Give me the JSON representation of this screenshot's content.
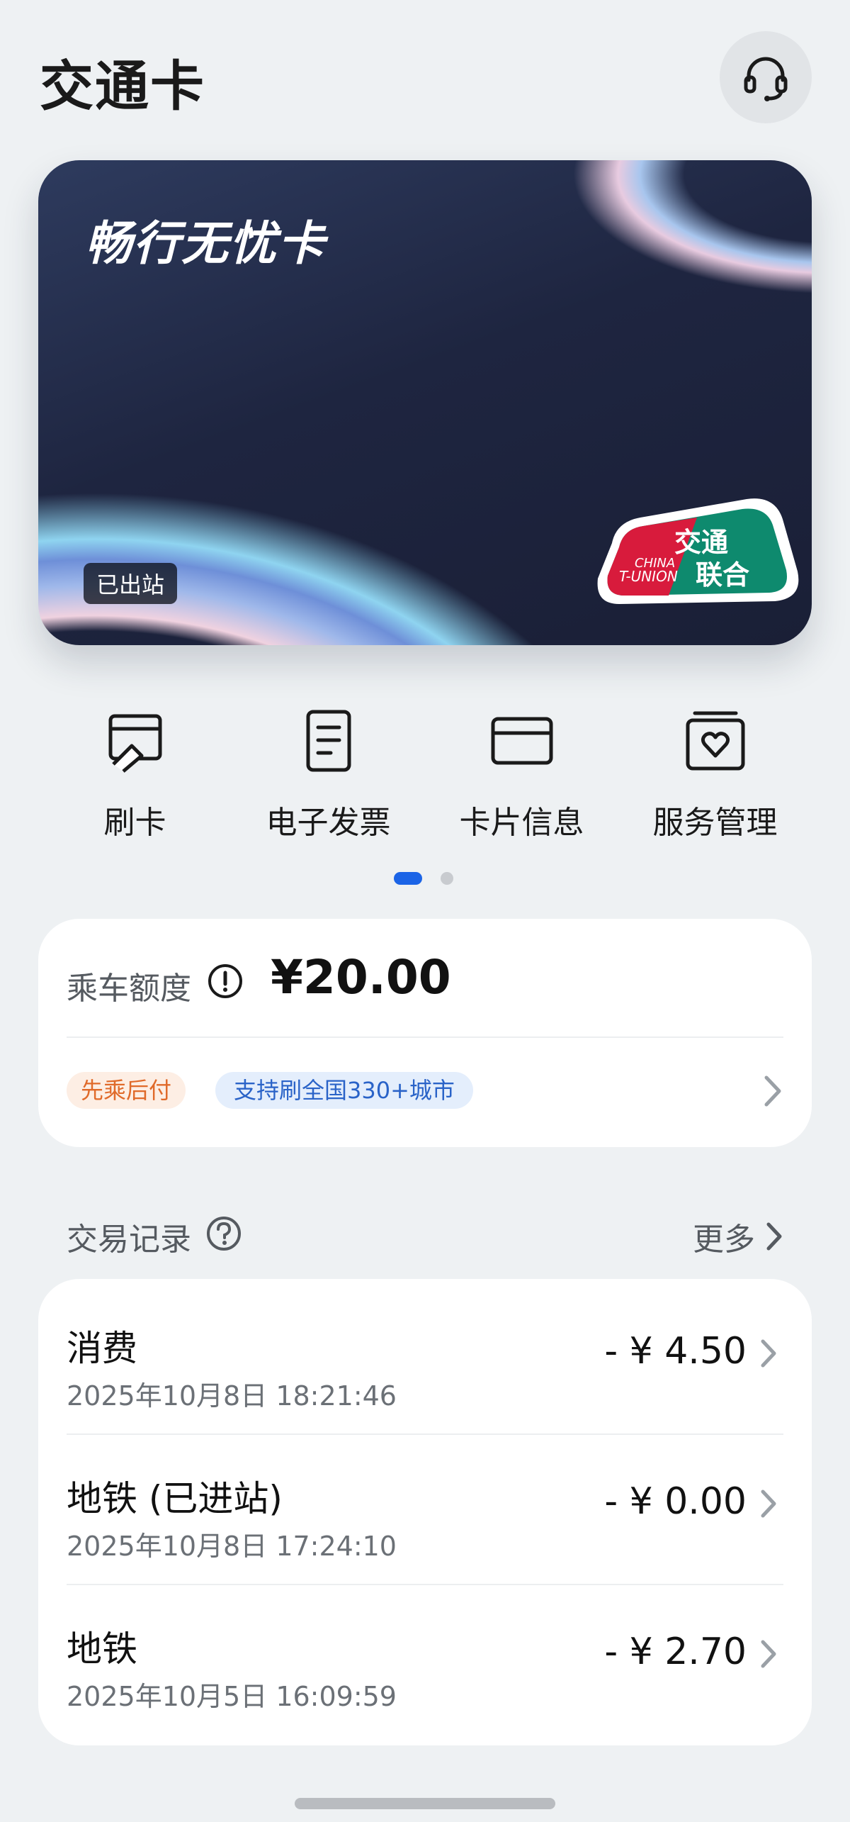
{
  "header": {
    "title": "交通卡"
  },
  "card": {
    "name": "畅行无忧卡",
    "status": "已出站",
    "logo_cn": "交通联合",
    "logo_en_1": "CHINA",
    "logo_en_2": "T-UNION"
  },
  "actions": [
    {
      "label": "刷卡",
      "icon": "swipe-card-icon"
    },
    {
      "label": "电子发票",
      "icon": "invoice-icon"
    },
    {
      "label": "卡片信息",
      "icon": "card-info-icon"
    },
    {
      "label": "服务管理",
      "icon": "service-manage-icon"
    }
  ],
  "pager": {
    "current": 1,
    "total": 2
  },
  "credit": {
    "label": "乘车额度",
    "amount": "¥20.00",
    "tags": [
      "先乘后付",
      "支持刷全国330+城市"
    ]
  },
  "transactions": {
    "title": "交易记录",
    "more": "更多",
    "items": [
      {
        "title": "消费",
        "date": "2025年10月8日 18:21:46",
        "amount": "- ¥ 4.50"
      },
      {
        "title": "地铁 (已进站)",
        "date": "2025年10月8日 17:24:10",
        "amount": "- ¥ 0.00"
      },
      {
        "title": "地铁",
        "date": "2025年10月5日 16:09:59",
        "amount": "- ¥ 2.70"
      }
    ]
  },
  "colors": {
    "accent": "#1b64e6",
    "tag_orange": "#e06a2a",
    "tag_blue": "#2a63c8",
    "background": "#eef1f3"
  }
}
